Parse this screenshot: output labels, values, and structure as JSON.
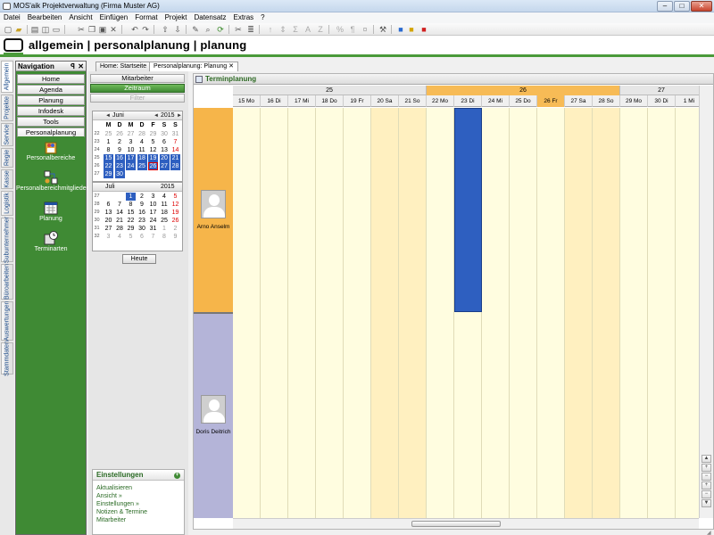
{
  "window": {
    "title": "MOS'aik Projektverwaltung (Firma Muster AG)",
    "min": "–",
    "max": "□",
    "close": "✕"
  },
  "menu": [
    "Datei",
    "Bearbeiten",
    "Ansicht",
    "Einfügen",
    "Format",
    "Projekt",
    "Datensatz",
    "Extras",
    "?"
  ],
  "breadcrumb": "allgemein | personalplanung | planung",
  "sidetabs": [
    "Allgemein",
    "Projekte",
    "Service",
    "Regie",
    "Kasse",
    "Logistik",
    "Subunternehmer",
    "Büroarbeiten",
    "Auswertungen",
    "Stammdaten"
  ],
  "nav": {
    "title": "Navigation",
    "pin": "ꟼ",
    "close": "✕",
    "buttons": [
      "Home",
      "Agenda",
      "Planung",
      "Infodesk",
      "Tools",
      "Personalplanung"
    ],
    "items": [
      "Personalbereiche",
      "Personalbereichmitglieder",
      "Planung",
      "Terminarten"
    ]
  },
  "tabs": [
    "Home: Startseite",
    "Personalplanung: Planung"
  ],
  "tab_close": "✕",
  "mid": {
    "buttons": [
      "Mitarbeiter",
      "Zeitraum",
      "Filter"
    ]
  },
  "cal_june": {
    "month": "Juni",
    "year": "2015",
    "nav_prev": "◄",
    "nav_next": "►",
    "dow": [
      "M",
      "D",
      "M",
      "D",
      "F",
      "S",
      "S"
    ],
    "weeks": [
      "22",
      "23",
      "24",
      "25",
      "26",
      "27"
    ],
    "days": [
      [
        "25",
        "26",
        "27",
        "28",
        "29",
        "30",
        "31"
      ],
      [
        "1",
        "2",
        "3",
        "4",
        "5",
        "6",
        "7"
      ],
      [
        "8",
        "9",
        "10",
        "11",
        "12",
        "13",
        "14"
      ],
      [
        "15",
        "16",
        "17",
        "18",
        "19",
        "20",
        "21"
      ],
      [
        "22",
        "23",
        "24",
        "25",
        "26",
        "27",
        "28"
      ],
      [
        "29",
        "30",
        "",
        "",
        "",
        "",
        ""
      ]
    ]
  },
  "cal_july": {
    "month": "Juli",
    "year": "2015",
    "weeks": [
      "27",
      "28",
      "29",
      "30",
      "31",
      "32"
    ],
    "days": [
      [
        "",
        "",
        "1",
        "2",
        "3",
        "4",
        "5"
      ],
      [
        "6",
        "7",
        "8",
        "9",
        "10",
        "11",
        "12"
      ],
      [
        "13",
        "14",
        "15",
        "16",
        "17",
        "18",
        "19"
      ],
      [
        "20",
        "21",
        "22",
        "23",
        "24",
        "25",
        "26"
      ],
      [
        "27",
        "28",
        "29",
        "30",
        "31",
        "1",
        "2"
      ],
      [
        "3",
        "4",
        "5",
        "6",
        "7",
        "8",
        "9"
      ]
    ]
  },
  "today_button": "Heute",
  "settings": {
    "title": "Einstellungen",
    "toggle": "+",
    "items": [
      "Aktualisieren",
      "Ansicht »",
      "Einstellungen »",
      "Notizen & Termine",
      "Mitarbeiter"
    ]
  },
  "scheduler": {
    "title": "Terminplanung",
    "weeks": [
      "25",
      "26",
      "27"
    ],
    "days": [
      "15 Mo",
      "16 Di",
      "17 Mi",
      "18 Do",
      "19 Fr",
      "20 Sa",
      "21 So",
      "22 Mo",
      "23 Di",
      "24 Mi",
      "25 Do",
      "26 Fr",
      "27 Sa",
      "28 So",
      "29 Mo",
      "30 Di",
      "1 Mi"
    ],
    "today_index": 11,
    "weekend_indices": [
      5,
      6,
      12,
      13
    ],
    "resources": [
      {
        "name": "Arno Anselm",
        "color": "#f6b54a"
      },
      {
        "name": "Doris Deitrich",
        "color": "#b4b4d8"
      }
    ],
    "events": [
      {
        "resource": 0,
        "day_index": 8,
        "color": "#2e5fc0"
      }
    ]
  },
  "colors": {
    "accent_green": "#3f8a34",
    "today_orange": "#f7bb56",
    "grid_bg": "#fffde0",
    "weekend_bg": "#fff0c0"
  }
}
